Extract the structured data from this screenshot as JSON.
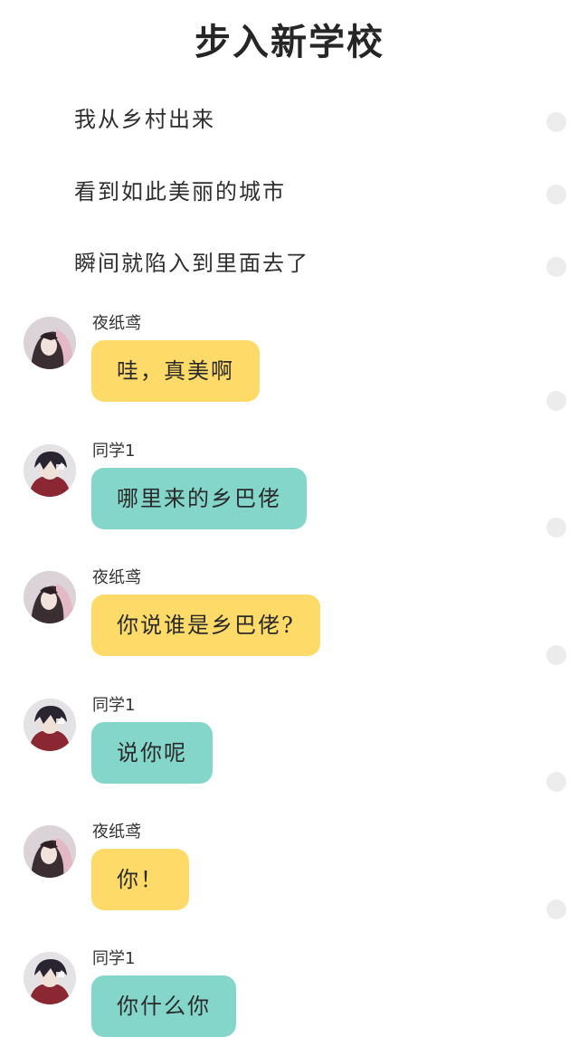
{
  "page": {
    "title": "步入新学校"
  },
  "narration": [
    "我从乡村出来",
    "看到如此美丽的城市",
    "瞬间就陷入到里面去了"
  ],
  "messages": [
    {
      "speaker": "夜纸鸢",
      "text": "哇，真美啊",
      "bubble_color": "#fedb69",
      "avatar": "girl-avatar"
    },
    {
      "speaker": "同学1",
      "text": "哪里来的乡巴佬",
      "bubble_color": "#85d6ca",
      "avatar": "boy-avatar"
    },
    {
      "speaker": "夜纸鸢",
      "text": "你说谁是乡巴佬?",
      "bubble_color": "#fedb69",
      "avatar": "girl-avatar"
    },
    {
      "speaker": "同学1",
      "text": "说你呢",
      "bubble_color": "#85d6ca",
      "avatar": "boy-avatar"
    },
    {
      "speaker": "夜纸鸢",
      "text": "你！",
      "bubble_color": "#fedb69",
      "avatar": "girl-avatar"
    },
    {
      "speaker": "同学1",
      "text": "你什么你",
      "bubble_color": "#85d6ca",
      "avatar": "boy-avatar"
    }
  ]
}
